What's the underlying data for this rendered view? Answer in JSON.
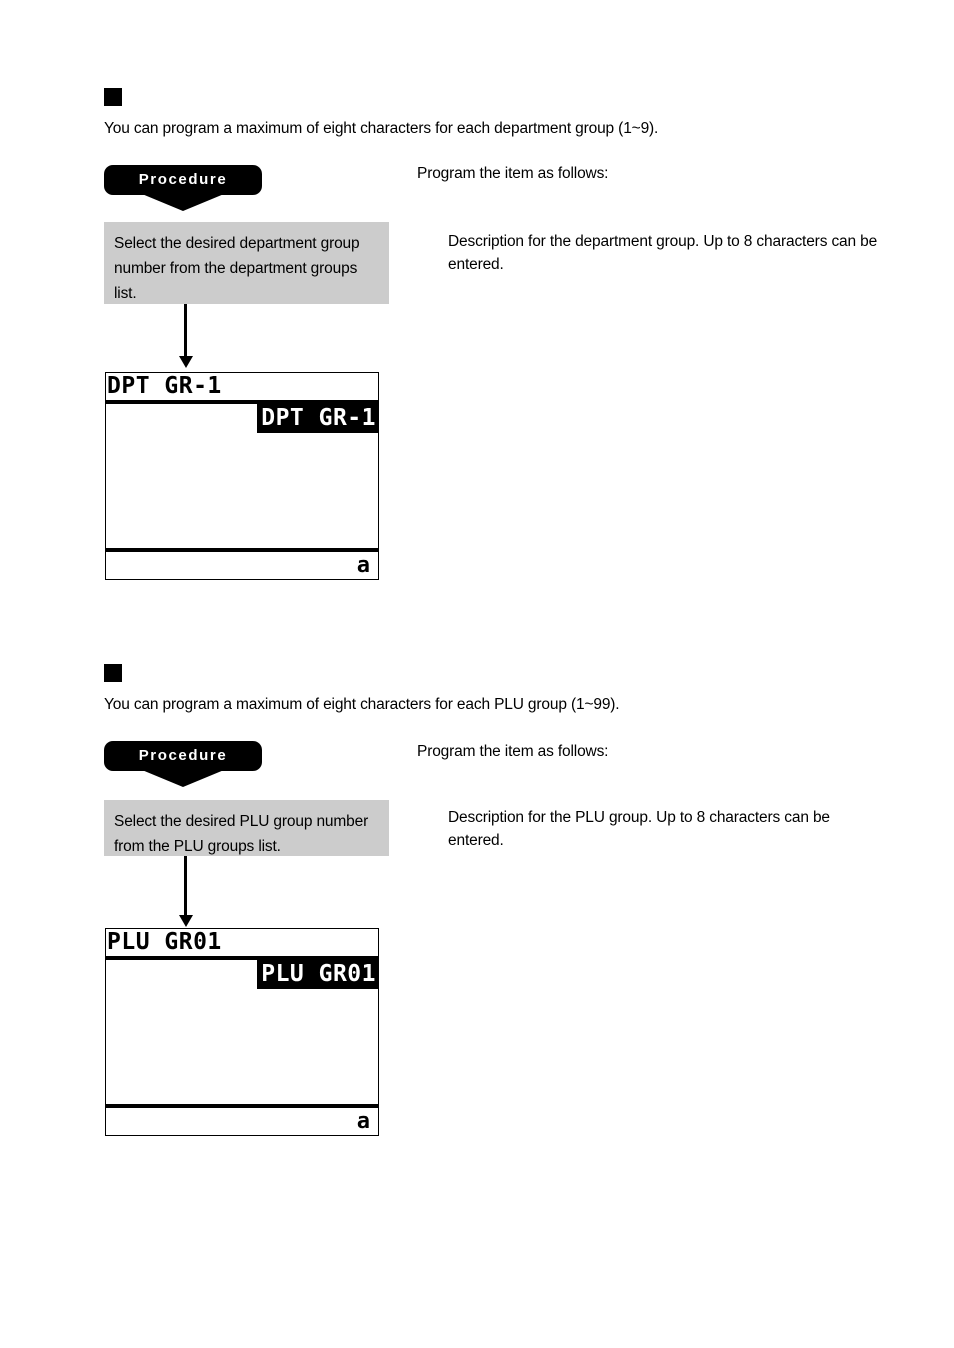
{
  "page": {
    "background_color": "#ffffff",
    "accent_color": "#000000",
    "step_box_color": "#cccccc"
  },
  "sections": [
    {
      "id": "department-group",
      "bullet": "black-square",
      "intro": "You can program a maximum of eight characters for each department group (1~9).",
      "procedure_label": "Procedure",
      "right_lead": "Program the item as follows:",
      "step_box": "Select the desired department group number from the department groups list.",
      "right_description": "Description for the department group. Up to 8 characters can be entered.",
      "lcd": {
        "title": "DPT GR-1",
        "highlight": "DPT GR-1",
        "status": "a"
      }
    },
    {
      "id": "plu-group",
      "bullet": "black-square",
      "intro": "You can program a maximum of eight characters for each PLU group (1~99).",
      "procedure_label": "Procedure",
      "right_lead": "Program the item as follows:",
      "step_box": "Select the desired PLU group number from the PLU  groups list.",
      "right_description": "Description for the PLU group. Up to 8 characters can be entered.",
      "lcd": {
        "title": "PLU GR01",
        "highlight": "PLU GR01",
        "status": "a"
      }
    }
  ]
}
